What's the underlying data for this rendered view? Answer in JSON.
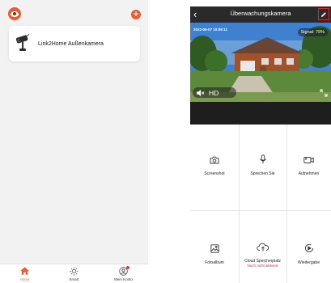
{
  "left_screen": {
    "device_card": {
      "name": "Link2Home Außenkamera"
    },
    "tabbar": {
      "tabs": [
        {
          "label": "Home",
          "icon": "home-icon",
          "active": true
        },
        {
          "label": "Smart",
          "icon": "sun-icon",
          "active": false
        },
        {
          "label": "Mein Konto",
          "icon": "profile-icon",
          "active": false,
          "badge": true
        }
      ]
    }
  },
  "right_screen": {
    "header": {
      "title": "Überwachungskamera"
    },
    "video": {
      "timestamp": "2022-05-07 10:09:11",
      "signal": "Signal: 79%",
      "quality": "HD"
    },
    "actions": [
      {
        "label": "Screenshot",
        "icon": "camera-icon"
      },
      {
        "label": "Sprechen Sie",
        "icon": "microphone-icon"
      },
      {
        "label": "Aufnehmen",
        "icon": "video-record-icon"
      },
      {
        "label": "Fotoalbum",
        "icon": "photo-album-icon"
      },
      {
        "label": "Cloud Speicherplatz",
        "sublabel": "Noch nicht aktiviert",
        "icon": "cloud-upload-icon"
      },
      {
        "label": "Wiedergabe",
        "icon": "playback-icon"
      }
    ]
  },
  "colors": {
    "accent": "#ee5a2e",
    "header_bg": "#2a2a2a",
    "highlight_red": "#e0242a"
  }
}
